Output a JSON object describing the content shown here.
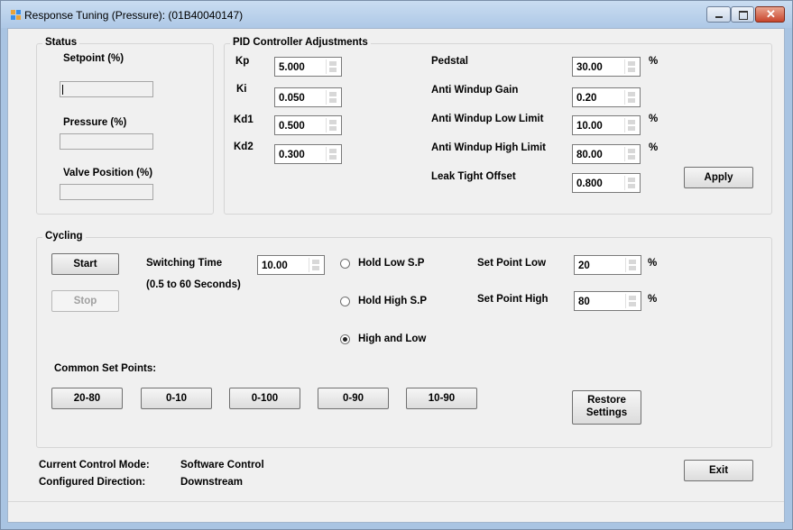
{
  "window": {
    "title": "Response Tuning (Pressure): (01B40040147)"
  },
  "status": {
    "group_title": "Status",
    "setpoint_label": "Setpoint (%)",
    "setpoint_value": "",
    "pressure_label": "Pressure (%)",
    "pressure_value": "",
    "valve_label": "Valve Position (%)",
    "valve_value": ""
  },
  "pid": {
    "group_title": "PID Controller Adjustments",
    "kp_label": "Kp",
    "kp_value": "5.000",
    "ki_label": "Ki",
    "ki_value": "0.050",
    "kd1_label": "Kd1",
    "kd1_value": "0.500",
    "kd2_label": "Kd2",
    "kd2_value": "0.300",
    "pedstal_label": "Pedstal",
    "pedstal_value": "30.00",
    "pedstal_unit": "%",
    "awg_label": "Anti Windup Gain",
    "awg_value": "0.20",
    "awl_label": "Anti Windup Low Limit",
    "awl_value": "10.00",
    "awl_unit": "%",
    "awh_label": "Anti Windup High Limit",
    "awh_value": "80.00",
    "awh_unit": "%",
    "leak_label": "Leak Tight Offset",
    "leak_value": "0.800",
    "apply_label": "Apply"
  },
  "cycling": {
    "group_title": "Cycling",
    "start_label": "Start",
    "stop_label": "Stop",
    "switching_label": "Switching Time",
    "switching_value": "10.00",
    "switching_hint": "(0.5 to 60 Seconds)",
    "radio_hold_low": "Hold Low S.P",
    "radio_hold_high": "Hold High S.P",
    "radio_high_low": "High and Low",
    "selected_mode": "High and Low",
    "sp_low_label": "Set Point Low",
    "sp_low_value": "20",
    "sp_low_unit": "%",
    "sp_high_label": "Set Point High",
    "sp_high_value": "80",
    "sp_high_unit": "%",
    "common_label": "Common Set Points:",
    "presets": [
      "20-80",
      "0-10",
      "0-100",
      "0-90",
      "10-90"
    ],
    "restore_line1": "Restore",
    "restore_line2": "Settings"
  },
  "footer": {
    "mode_label": "Current Control Mode:",
    "mode_value": "Software Control",
    "direction_label": "Configured Direction:",
    "direction_value": "Downstream",
    "exit_label": "Exit"
  }
}
